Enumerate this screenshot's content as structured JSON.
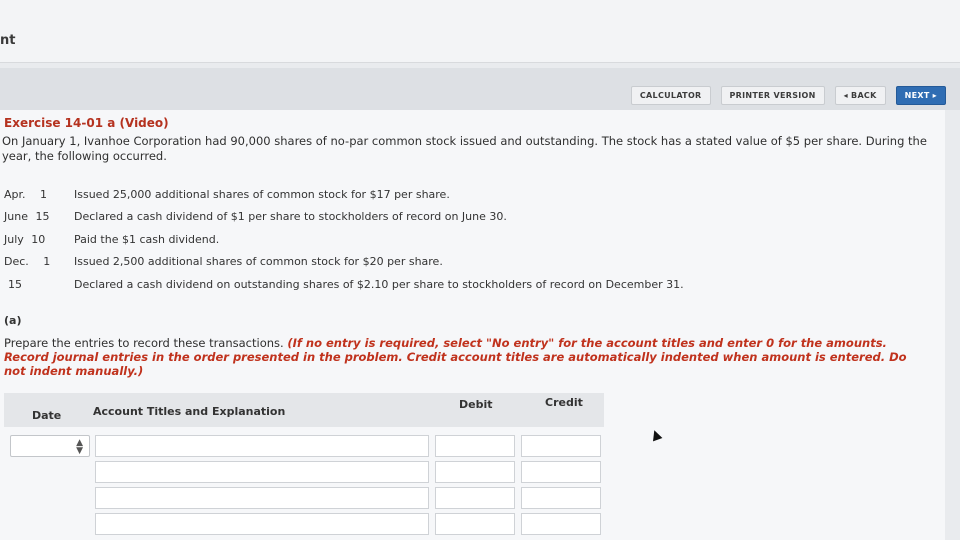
{
  "header": {
    "title_fragment": "nt"
  },
  "toolbar": {
    "calculator": "CALCULATOR",
    "printer_version": "PRINTER VERSION",
    "back": "◂ BACK",
    "next": "NEXT ▸"
  },
  "exercise": {
    "title": "Exercise 14-01 a (Video)",
    "intro": "On January 1, Ivanhoe Corporation had 90,000 shares of no-par common stock issued and outstanding. The stock has a stated value of $5 per share. During the year, the following occurred.",
    "events": [
      {
        "month": "Apr.",
        "day": "1",
        "text": "Issued 25,000 additional shares of common stock for $17 per share."
      },
      {
        "month": "June",
        "day": "15",
        "text": "Declared a cash dividend of $1 per share to stockholders of record on June 30."
      },
      {
        "month": "July",
        "day": "10",
        "text": "Paid the $1 cash dividend."
      },
      {
        "month": "Dec.",
        "day": "1",
        "text": "Issued 2,500 additional shares of common stock for $20 per share."
      },
      {
        "month": "",
        "day": "15",
        "text": "Declared a cash dividend on outstanding shares of $2.10 per share to stockholders of record on December 31."
      }
    ]
  },
  "part_a": {
    "label": "(a)",
    "instruction_plain": "Prepare the entries to record these transactions. ",
    "instruction_red": "(If no entry is required, select \"No entry\" for the account titles and enter 0 for the amounts. Record journal entries in the order presented in the problem. Credit account titles are automatically indented when amount is entered. Do not indent manually.)"
  },
  "table": {
    "headers": {
      "date": "Date",
      "account": "Account Titles and Explanation",
      "debit": "Debit",
      "credit": "Credit"
    },
    "date_select_value": ""
  }
}
